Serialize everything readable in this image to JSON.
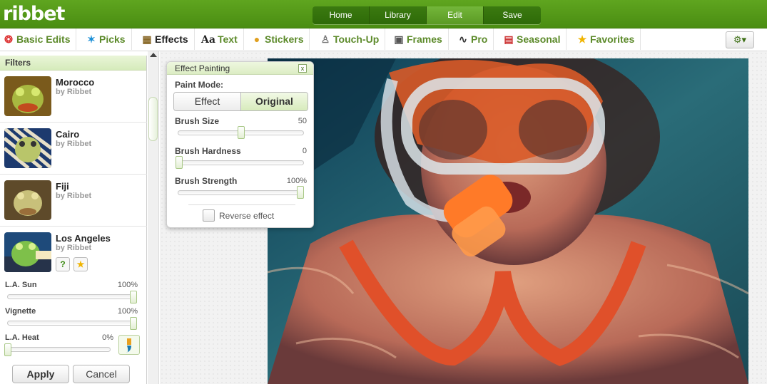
{
  "app": {
    "logo": "ribbet"
  },
  "mainnav": [
    {
      "label": "Home",
      "active": false
    },
    {
      "label": "Library",
      "active": false
    },
    {
      "label": "Edit",
      "active": true
    },
    {
      "label": "Save",
      "active": false
    }
  ],
  "toolbar": [
    {
      "label": "Basic Edits",
      "icon": "lifebuoy-icon",
      "glyph": "❂"
    },
    {
      "label": "Picks",
      "icon": "star-icon",
      "glyph": "✶"
    },
    {
      "label": "Effects",
      "icon": "film-icon",
      "glyph": "▦",
      "active": true
    },
    {
      "label": "Text",
      "icon": "text-icon",
      "glyph": "Aa"
    },
    {
      "label": "Stickers",
      "icon": "ball-icon",
      "glyph": "●"
    },
    {
      "label": "Touch-Up",
      "icon": "person-icon",
      "glyph": "♙"
    },
    {
      "label": "Frames",
      "icon": "frame-icon",
      "glyph": "▣"
    },
    {
      "label": "Pro",
      "icon": "curve-icon",
      "glyph": "∿"
    },
    {
      "label": "Seasonal",
      "icon": "calendar-icon",
      "glyph": "▤"
    },
    {
      "label": "Favorites",
      "icon": "star-icon",
      "glyph": "★"
    }
  ],
  "settings": {
    "glyph": "⚙▾"
  },
  "sidebar": {
    "title": "Filters",
    "filters": [
      {
        "name": "Morocco",
        "by": "by Ribbet"
      },
      {
        "name": "Cairo",
        "by": "by Ribbet"
      },
      {
        "name": "Fiji",
        "by": "by Ribbet"
      },
      {
        "name": "Los Angeles",
        "by": "by Ribbet"
      }
    ],
    "help_glyph": "?",
    "fav_glyph": "★",
    "sliders": [
      {
        "label": "L.A. Sun",
        "value": "100%",
        "level": 1.0
      },
      {
        "label": "Vignette",
        "value": "100%",
        "level": 1.0
      },
      {
        "label": "L.A. Heat",
        "value": "0%",
        "level": 0.0
      }
    ],
    "apply": "Apply",
    "cancel": "Cancel"
  },
  "panel": {
    "title": "Effect Painting",
    "close_glyph": "x",
    "paint_mode_label": "Paint Mode:",
    "modes": [
      {
        "label": "Effect",
        "active": false
      },
      {
        "label": "Original",
        "active": true
      }
    ],
    "sliders": [
      {
        "label": "Brush Size",
        "value": "50",
        "level": 0.5
      },
      {
        "label": "Brush Hardness",
        "value": "0",
        "level": 0.0
      },
      {
        "label": "Brush Strength",
        "value": "100%",
        "level": 1.0
      }
    ],
    "reverse_label": "Reverse effect"
  },
  "colors": {
    "brand_green": "#5fa51f",
    "link_green": "#5c8a2a"
  }
}
